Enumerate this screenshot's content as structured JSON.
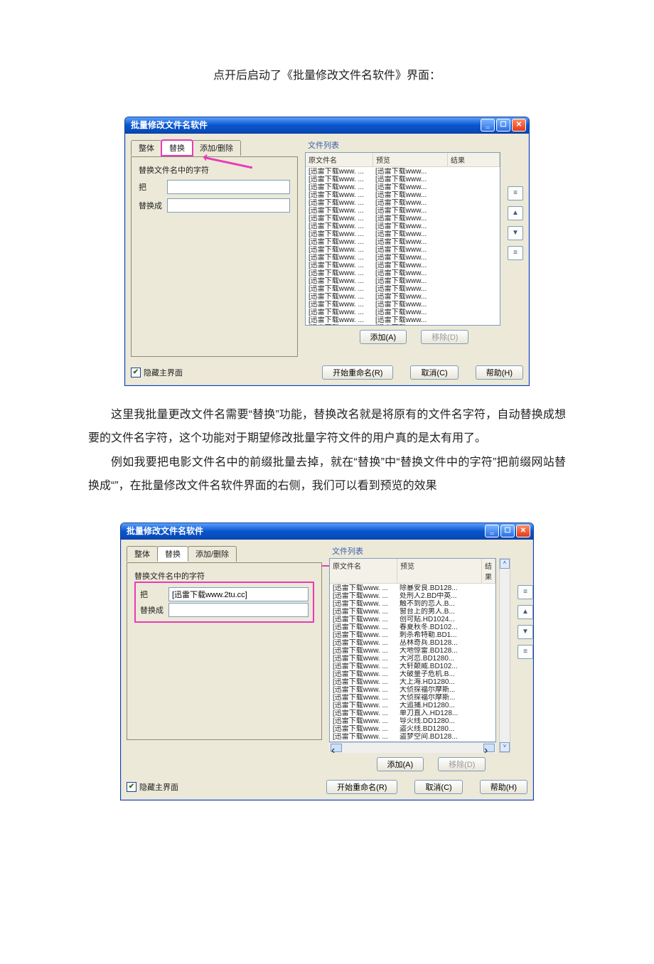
{
  "doc": {
    "intro": "点开后启动了《批量修改文件名软件》界面：",
    "para1": "这里我批量更改文件名需要“替换”功能，替换改名就是将原有的文件名字符，自动替换成想要的文件名字符，这个功能对于期望修改批量字符文件的用户真的是太有用了。",
    "para2": "例如我要把电影文件名中的前缀批量去掉，就在“替换”中“替换文件中的字符”把前缀网站替换成“”，在批量修改文件名软件界面的右侧，我们可以看到预览的效果"
  },
  "common": {
    "title": "批量修改文件名软件",
    "tabs": {
      "whole": "整体",
      "replace": "替换",
      "adddel": "添加/删除"
    },
    "panel_label": "替换文件名中的字符",
    "field_from": "把",
    "field_to": "替换成",
    "group_title": "文件列表",
    "columns": {
      "name": "原文件名",
      "preview": "预览",
      "result": "结果"
    },
    "buttons": {
      "add": "添加(A)",
      "remove": "移除(D)",
      "start": "开始重命名(R)",
      "cancel": "取消(C)",
      "help": "帮助(H)"
    },
    "hide_main": "隐藏主界面",
    "side": {
      "top": "≡",
      "up": "▲",
      "down": "▼",
      "bottom": "≡"
    }
  },
  "shot1": {
    "from_value": "",
    "to_value": "",
    "rows": [
      {
        "name": "[迅雷下载www. ...",
        "preview": "[迅雷下载www..."
      },
      {
        "name": "[迅雷下载www. ...",
        "preview": "[迅雷下载www..."
      },
      {
        "name": "[迅雷下载www. ...",
        "preview": "[迅雷下载www..."
      },
      {
        "name": "[迅雷下载www. ...",
        "preview": "[迅雷下载www..."
      },
      {
        "name": "[迅雷下载www. ...",
        "preview": "[迅雷下载www..."
      },
      {
        "name": "[迅雷下载www. ...",
        "preview": "[迅雷下载www..."
      },
      {
        "name": "[迅雷下载www. ...",
        "preview": "[迅雷下载www..."
      },
      {
        "name": "[迅雷下载www. ...",
        "preview": "[迅雷下载www..."
      },
      {
        "name": "[迅雷下载www. ...",
        "preview": "[迅雷下载www..."
      },
      {
        "name": "[迅雷下载www. ...",
        "preview": "[迅雷下载www..."
      },
      {
        "name": "[迅雷下载www. ...",
        "preview": "[迅雷下载www..."
      },
      {
        "name": "[迅雷下载www. ...",
        "preview": "[迅雷下载www..."
      },
      {
        "name": "[迅雷下载www. ...",
        "preview": "[迅雷下载www..."
      },
      {
        "name": "[迅雷下载www. ...",
        "preview": "[迅雷下载www..."
      },
      {
        "name": "[迅雷下载www. ...",
        "preview": "[迅雷下载www..."
      },
      {
        "name": "[迅雷下载www. ...",
        "preview": "[迅雷下载www..."
      },
      {
        "name": "[迅雷下载www. ...",
        "preview": "[迅雷下载www..."
      },
      {
        "name": "[迅雷下载www. ...",
        "preview": "[迅雷下载www..."
      },
      {
        "name": "[迅雷下载www. ...",
        "preview": "[迅雷下载www..."
      },
      {
        "name": "[迅雷下载www. ...",
        "preview": "[迅雷下载www..."
      },
      {
        "name": "[迅雷下载www. ...",
        "preview": "[迅雷下载www..."
      }
    ]
  },
  "shot2": {
    "from_value": "[迅雷下载www.2tu.cc]",
    "to_value": "",
    "rows": [
      {
        "name": "[迅雷下载www. ...",
        "preview": "除暴安良.BD128..."
      },
      {
        "name": "[迅雷下载www. ...",
        "preview": "处刑人2.BD中英..."
      },
      {
        "name": "[迅雷下载www. ...",
        "preview": "触不到的恋人.B..."
      },
      {
        "name": "[迅雷下载www. ...",
        "preview": "窗台上的男人.B..."
      },
      {
        "name": "[迅雷下载www. ...",
        "preview": "创可贴.HD1024..."
      },
      {
        "name": "[迅雷下载www. ...",
        "preview": "春夏秋冬.BD102..."
      },
      {
        "name": "[迅雷下载www. ...",
        "preview": "刺杀希特勒.BD1..."
      },
      {
        "name": "[迅雷下载www. ...",
        "preview": "丛林奇兵.BD128..."
      },
      {
        "name": "[迅雷下载www. ...",
        "preview": "大地惊雷.BD128..."
      },
      {
        "name": "[迅雷下载www. ...",
        "preview": "大河恋.BD1280..."
      },
      {
        "name": "[迅雷下载www. ...",
        "preview": "大轩颠威.BD102..."
      },
      {
        "name": "[迅雷下载www. ...",
        "preview": "大破量子危机.B..."
      },
      {
        "name": "[迅雷下载www. ...",
        "preview": "大上海.HD1280..."
      },
      {
        "name": "[迅雷下载www. ...",
        "preview": "大侦探福尔摩斯..."
      },
      {
        "name": "[迅雷下载www. ...",
        "preview": "大侦探福尔摩斯..."
      },
      {
        "name": "[迅雷下载www. ...",
        "preview": "大追捕.HD1280..."
      },
      {
        "name": "[迅雷下载www. ...",
        "preview": "单刀直入.HD128..."
      },
      {
        "name": "[迅雷下载www. ...",
        "preview": "导火线.DD1280..."
      },
      {
        "name": "[迅雷下载www. ...",
        "preview": "盗火线.BD1280..."
      },
      {
        "name": "[迅雷下载www. ...",
        "preview": "盗梦空间.BD128..."
      }
    ]
  }
}
